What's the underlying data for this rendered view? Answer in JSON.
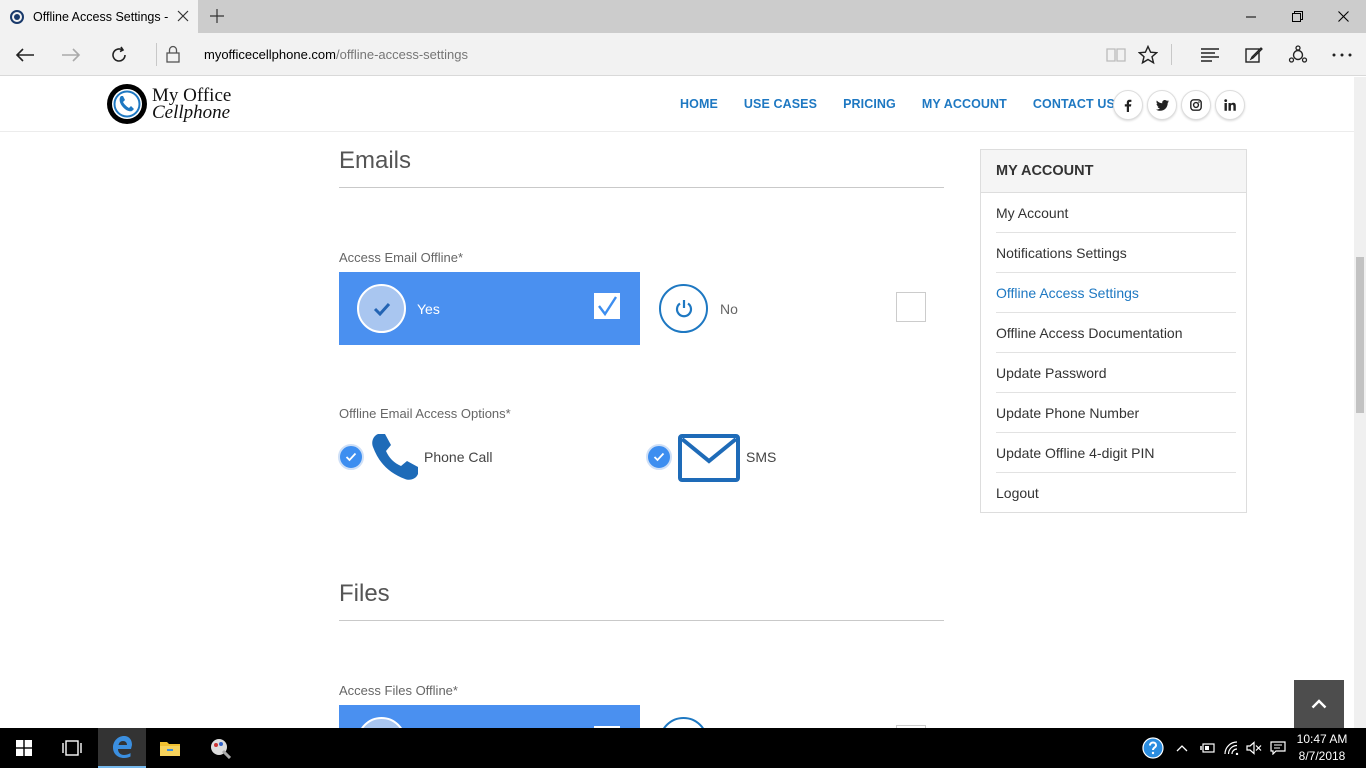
{
  "browser": {
    "tab_title": "Offline Access Settings -",
    "url_domain": "myofficecellphone.com",
    "url_path": "/offline-access-settings"
  },
  "site": {
    "logo_line1": "My Office",
    "logo_line2": "Cellphone",
    "nav": [
      "HOME",
      "USE CASES",
      "PRICING",
      "MY ACCOUNT",
      "CONTACT US"
    ],
    "social": [
      "f",
      "t",
      "ig",
      "in"
    ]
  },
  "emails": {
    "title": "Emails",
    "access_label": "Access Email Offline*",
    "yes_label": "Yes",
    "no_label": "No",
    "options_label": "Offline Email Access Options*",
    "option_phone": "Phone Call",
    "option_sms": "SMS"
  },
  "files": {
    "title": "Files",
    "access_label": "Access Files Offline*"
  },
  "sidebar": {
    "heading": "MY ACCOUNT",
    "items": [
      "My Account",
      "Notifications Settings",
      "Offline Access Settings",
      "Offline Access Documentation",
      "Update Password",
      "Update Phone Number",
      "Update Offline 4-digit PIN",
      "Logout"
    ],
    "active_index": 2
  },
  "taskbar": {
    "time": "10:47 AM",
    "date": "8/7/2018"
  },
  "colors": {
    "accent": "#1e78c2",
    "selected_fill": "#4a90f0"
  }
}
